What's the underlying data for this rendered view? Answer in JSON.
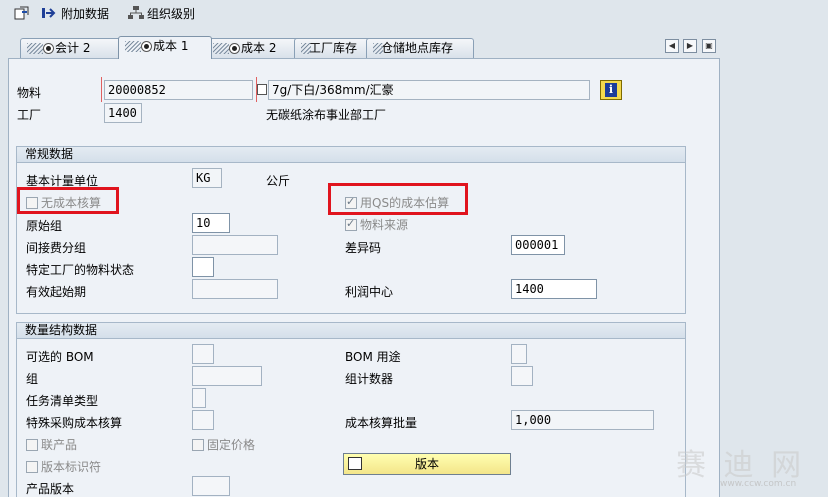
{
  "toolbar": {
    "additional_data": "附加数据",
    "org_levels": "组织级别"
  },
  "tabs": [
    {
      "label": "会计 2"
    },
    {
      "label": "成本 1"
    },
    {
      "label": "成本 2"
    },
    {
      "label": "工厂库存"
    },
    {
      "label": "仓储地点库存"
    }
  ],
  "header": {
    "material_label": "物料",
    "material_value": "20000852",
    "material_desc": "7g/下白/368mm/汇豪",
    "plant_label": "工厂",
    "plant_value": "1400",
    "plant_desc": "无碳纸涂布事业部工厂"
  },
  "general": {
    "title": "常规数据",
    "base_uom_label": "基本计量单位",
    "base_uom_value": "KG",
    "base_uom_text": "公斤",
    "no_costing_label": "无成本核算",
    "qs_cost_label": "用QS的成本估算",
    "origin_group_label": "原始组",
    "origin_group_value": "10",
    "material_origin_label": "物料来源",
    "overhead_group_label": "间接费分组",
    "overhead_group_value": "",
    "variance_key_label": "差异码",
    "variance_key_value": "000001",
    "plant_status_label": "特定工厂的物料状态",
    "plant_status_value": "",
    "valid_from_label": "有效起始期",
    "valid_from_value": "",
    "profit_center_label": "利润中心",
    "profit_center_value": "1400"
  },
  "quantity": {
    "title": "数量结构数据",
    "alt_bom_label": "可选的 BOM",
    "alt_bom_value": "",
    "bom_usage_label": "BOM 用途",
    "bom_usage_value": "",
    "group_label": "组",
    "group_value": "",
    "group_counter_label": "组计数器",
    "group_counter_value": "",
    "task_list_type_label": "任务清单类型",
    "task_list_type_value": "",
    "special_proc_label": "特殊采购成本核算",
    "special_proc_value": "",
    "costing_lot_label": "成本核算批量",
    "costing_lot_value": "1,000",
    "coproduct_label": "联产品",
    "fixed_price_label": "固定价格",
    "version_indicator_label": "版本标识符",
    "version_button": "版本",
    "prod_version_label": "产品版本",
    "prod_version_value": ""
  },
  "watermark": {
    "text": "赛 迪 网",
    "sub": "www.ccw.com.cn"
  }
}
